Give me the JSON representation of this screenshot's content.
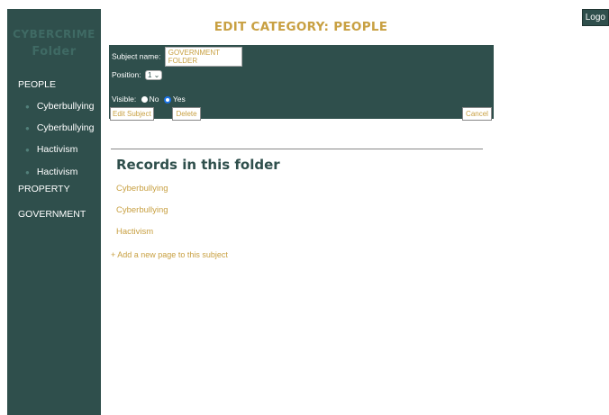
{
  "brand": {
    "line1": "CYBERCRIME",
    "line2": "Folder"
  },
  "nav": {
    "people": "PEOPLE",
    "children": [
      "Cyberbullying",
      "Cyberbullying",
      "Hactivism",
      "Hactivism"
    ],
    "property": "PROPERTY",
    "government": "GOVERNMENT"
  },
  "header": {
    "title": "EDIT CATEGORY: PEOPLE",
    "logout": "Logo"
  },
  "form": {
    "subject_label": "Subject name:",
    "subject_value": "GOVERNMENT FOLDER",
    "position_label": "Position:",
    "position_value": "1",
    "visible_label": "Visible:",
    "visible_no": "No",
    "visible_yes": "Yes",
    "edit_button": "Edit Subject",
    "delete_button": "Delete",
    "cancel_button": "Cancel"
  },
  "records": {
    "heading": "Records in this folder",
    "items": [
      "Cyberbullying",
      "Cyberbullying",
      "Hactivism"
    ],
    "add_link": "+ Add a new page to this subject"
  },
  "colors": {
    "sidebar": "#2f4f4c",
    "accent": "#c8a042"
  }
}
